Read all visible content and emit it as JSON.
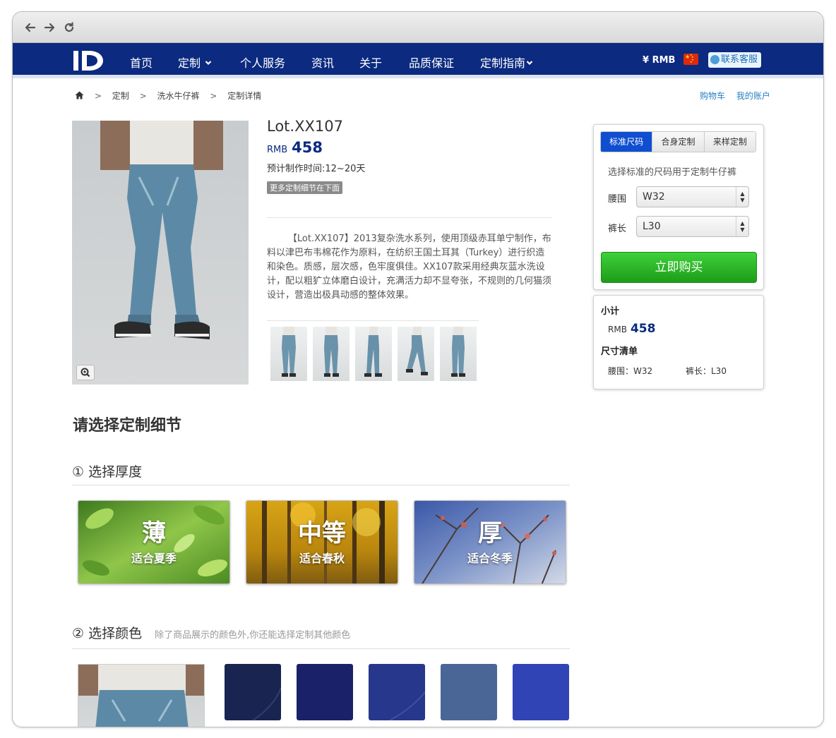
{
  "browser": {
    "back_icon": "back-arrow-icon",
    "forward_icon": "forward-arrow-icon",
    "reload_icon": "reload-icon"
  },
  "nav": {
    "logo": "ID",
    "items": [
      {
        "label": "首页",
        "dropdown": false
      },
      {
        "label": "定制",
        "dropdown": true
      },
      {
        "label": "个人服务",
        "dropdown": false
      },
      {
        "label": "资讯",
        "dropdown": false
      },
      {
        "label": "关于",
        "dropdown": false
      },
      {
        "label": "品质保证",
        "dropdown": false
      },
      {
        "label": "定制指南",
        "dropdown": true
      }
    ],
    "currency": "¥ RMB",
    "contact": "联系客服",
    "accent": "#0b2a80"
  },
  "breadcrumb": [
    "定制",
    "洗水牛仔裤",
    "定制详情"
  ],
  "account": {
    "cart": "购物车",
    "my_account": "我的账户"
  },
  "product": {
    "title": "Lot.XX107",
    "currency": "RMB",
    "price": "458",
    "lead_time": "预计制作时间:12~20天",
    "more_badge": "更多定制细节在下面",
    "description": "【Lot.XX107】2013复杂洗水系列，使用顶级赤耳单宁制作，布料以津巴布韦棉花作为原料，在纺织王国土耳其（Turkey）进行织造和染色。质感，层次感，色牢度俱佳。XX107款采用经典灰蓝水洗设计，配以粗犷立体磨白设计，充满活力却不显夸张，不规则的几何猫须设计，营造出极具动感的整体效果。",
    "thumb_count": 5
  },
  "buy_panel": {
    "tabs": [
      "标准尺码",
      "合身定制",
      "来样定制"
    ],
    "active_tab": 0,
    "description": "选择标准的尺码用于定制牛仔裤",
    "waist_label": "腰围",
    "waist_value": "W32",
    "length_label": "裤长",
    "length_value": "L30",
    "buy_label": "立即购买"
  },
  "summary": {
    "subtotal_label": "小计",
    "currency": "RMB",
    "price": "458",
    "size_list_label": "尺寸清单",
    "waist": "腰围：W32",
    "length": "裤长：L30"
  },
  "customize": {
    "title": "请选择定制细节",
    "step1": {
      "title": "① 选择厚度"
    },
    "thickness": [
      {
        "big": "薄",
        "small": "适合夏季",
        "theme": "green"
      },
      {
        "big": "中等",
        "small": "适合春秋",
        "theme": "autumn"
      },
      {
        "big": "厚",
        "small": "适合冬季",
        "theme": "winter"
      }
    ],
    "step2": {
      "title": "② 选择颜色",
      "subtitle": "除了商品展示的颜色外,你还能选择定制其他颜色"
    },
    "swatches": [
      "#1a2450",
      "#1a2168",
      "#26378c",
      "#4a6696",
      "#3044b5"
    ]
  }
}
